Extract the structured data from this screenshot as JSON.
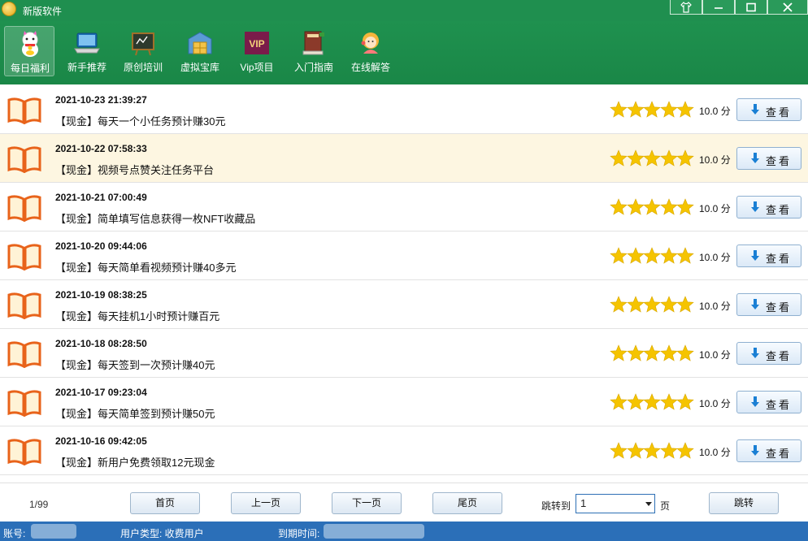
{
  "window": {
    "title": "新版软件",
    "controls": [
      "shirt-icon",
      "minimize-icon",
      "maximize-icon",
      "close-icon"
    ]
  },
  "toolbar": {
    "items": [
      {
        "label": "每日福利",
        "icon": "lucky-cat-icon",
        "active": true
      },
      {
        "label": "新手推荐",
        "icon": "laptop-icon",
        "active": false
      },
      {
        "label": "原创培训",
        "icon": "blackboard-icon",
        "active": false
      },
      {
        "label": "虚拟宝库",
        "icon": "warehouse-icon",
        "active": false
      },
      {
        "label": "Vip项目",
        "icon": "vip-icon",
        "active": false,
        "icon_text": "VIP"
      },
      {
        "label": "入门指南",
        "icon": "books-icon",
        "active": false
      },
      {
        "label": "在线解答",
        "icon": "support-agent-icon",
        "active": false
      }
    ]
  },
  "list": {
    "items": [
      {
        "date": "2021-10-23 21:39:27",
        "title": "【现金】每天一个小任务预计赚30元",
        "rating": 5,
        "score": "10.0 分",
        "button": "查看"
      },
      {
        "date": "2021-10-22 07:58:33",
        "title": "【现金】视频号点赞关注任务平台",
        "rating": 5,
        "score": "10.0 分",
        "button": "查看"
      },
      {
        "date": "2021-10-21 07:00:49",
        "title": "【现金】简单填写信息获得一枚NFT收藏品",
        "rating": 5,
        "score": "10.0 分",
        "button": "查看"
      },
      {
        "date": "2021-10-20 09:44:06",
        "title": "【现金】每天简单看视频预计赚40多元",
        "rating": 5,
        "score": "10.0 分",
        "button": "查看"
      },
      {
        "date": "2021-10-19 08:38:25",
        "title": "【现金】每天挂机1小时预计赚百元",
        "rating": 5,
        "score": "10.0 分",
        "button": "查看"
      },
      {
        "date": "2021-10-18 08:28:50",
        "title": "【现金】每天签到一次预计赚40元",
        "rating": 5,
        "score": "10.0 分",
        "button": "查看"
      },
      {
        "date": "2021-10-17 09:23:04",
        "title": "【现金】每天简单签到预计赚50元",
        "rating": 5,
        "score": "10.0 分",
        "button": "查看"
      },
      {
        "date": "2021-10-16 09:42:05",
        "title": "【现金】新用户免费领取12元现金",
        "rating": 5,
        "score": "10.0 分",
        "button": "查看"
      }
    ],
    "highlight_color": "#fdf6e1"
  },
  "pager": {
    "page_count": "1/99",
    "first": "首页",
    "prev": "上一页",
    "next": "下一页",
    "last": "尾页",
    "jump_label": "跳转到",
    "jump_value": "1",
    "page_unit": "页",
    "jump_button": "跳转"
  },
  "status": {
    "account_label": "账号:",
    "user_type": "用户类型: 收费用户",
    "expire_label": "到期时间:"
  },
  "colors": {
    "brand_green": "#1f8f4f",
    "status_blue": "#2b6fb8",
    "star": "#f5c400"
  }
}
